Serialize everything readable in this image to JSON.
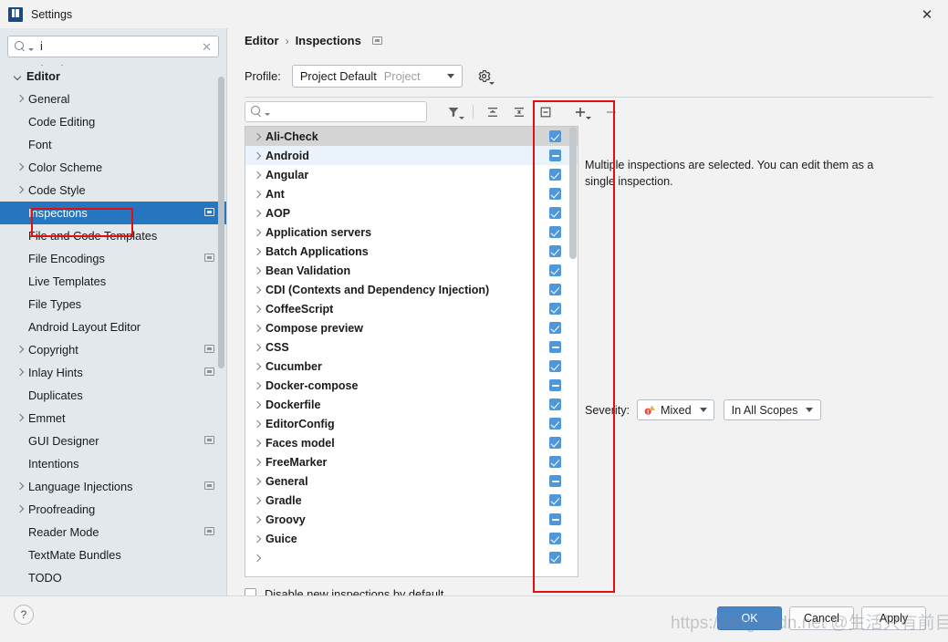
{
  "window": {
    "title": "Settings",
    "app_icon": "intellij-idea-icon",
    "close_label": "✕"
  },
  "sidebar": {
    "search": {
      "value": "i",
      "placeholder": "",
      "clear_label": "✕",
      "icon": "search-icon"
    },
    "partial_top_item": "· ·",
    "items": [
      {
        "label": "Editor",
        "depth": 0,
        "twisty": "down",
        "bold": true,
        "selected": false,
        "badge": false
      },
      {
        "label": "General",
        "depth": 1,
        "twisty": "right",
        "bold": false,
        "selected": false,
        "badge": false
      },
      {
        "label": "Code Editing",
        "depth": 1,
        "twisty": "none",
        "bold": false,
        "selected": false,
        "badge": false
      },
      {
        "label": "Font",
        "depth": 1,
        "twisty": "none",
        "bold": false,
        "selected": false,
        "badge": false
      },
      {
        "label": "Color Scheme",
        "depth": 1,
        "twisty": "right",
        "bold": false,
        "selected": false,
        "badge": false
      },
      {
        "label": "Code Style",
        "depth": 1,
        "twisty": "right",
        "bold": false,
        "selected": false,
        "badge": false
      },
      {
        "label": "Inspections",
        "depth": 1,
        "twisty": "none",
        "bold": false,
        "selected": true,
        "badge": true
      },
      {
        "label": "File and Code Templates",
        "depth": 1,
        "twisty": "none",
        "bold": false,
        "selected": false,
        "badge": false
      },
      {
        "label": "File Encodings",
        "depth": 1,
        "twisty": "none",
        "bold": false,
        "selected": false,
        "badge": true
      },
      {
        "label": "Live Templates",
        "depth": 1,
        "twisty": "none",
        "bold": false,
        "selected": false,
        "badge": false
      },
      {
        "label": "File Types",
        "depth": 1,
        "twisty": "none",
        "bold": false,
        "selected": false,
        "badge": false
      },
      {
        "label": "Android Layout Editor",
        "depth": 1,
        "twisty": "none",
        "bold": false,
        "selected": false,
        "badge": false
      },
      {
        "label": "Copyright",
        "depth": 1,
        "twisty": "right",
        "bold": false,
        "selected": false,
        "badge": true
      },
      {
        "label": "Inlay Hints",
        "depth": 1,
        "twisty": "right",
        "bold": false,
        "selected": false,
        "badge": true
      },
      {
        "label": "Duplicates",
        "depth": 1,
        "twisty": "none",
        "bold": false,
        "selected": false,
        "badge": false
      },
      {
        "label": "Emmet",
        "depth": 1,
        "twisty": "right",
        "bold": false,
        "selected": false,
        "badge": false
      },
      {
        "label": "GUI Designer",
        "depth": 1,
        "twisty": "none",
        "bold": false,
        "selected": false,
        "badge": true
      },
      {
        "label": "Intentions",
        "depth": 1,
        "twisty": "none",
        "bold": false,
        "selected": false,
        "badge": false
      },
      {
        "label": "Language Injections",
        "depth": 1,
        "twisty": "right",
        "bold": false,
        "selected": false,
        "badge": true
      },
      {
        "label": "Proofreading",
        "depth": 1,
        "twisty": "right",
        "bold": false,
        "selected": false,
        "badge": false
      },
      {
        "label": "Reader Mode",
        "depth": 1,
        "twisty": "none",
        "bold": false,
        "selected": false,
        "badge": true
      },
      {
        "label": "TextMate Bundles",
        "depth": 1,
        "twisty": "none",
        "bold": false,
        "selected": false,
        "badge": false
      },
      {
        "label": "TODO",
        "depth": 1,
        "twisty": "none",
        "bold": false,
        "selected": false,
        "badge": false
      }
    ]
  },
  "breadcrumb": {
    "parts": [
      "Editor",
      "Inspections"
    ],
    "separator": "›",
    "badge": "project-scope-badge"
  },
  "profile": {
    "label": "Profile:",
    "selected": "Project Default",
    "scope_hint": "Project",
    "gear_icon": "gear-icon"
  },
  "inspection_toolbar": {
    "search_placeholder": "",
    "search_value": "",
    "icons": [
      {
        "name": "filter-icon",
        "tooltip": "Filter"
      },
      {
        "name": "expand-all-icon",
        "tooltip": "Expand All"
      },
      {
        "name": "collapse-all-icon",
        "tooltip": "Collapse All"
      },
      {
        "name": "group-by-icon",
        "tooltip": "Group"
      },
      {
        "name": "add-icon",
        "tooltip": "Add"
      },
      {
        "name": "remove-icon",
        "tooltip": "Remove"
      }
    ]
  },
  "inspection_list": [
    {
      "label": "Ali-Check",
      "state": "checked",
      "row_highlight": "gray"
    },
    {
      "label": "Android",
      "state": "indeterminate",
      "row_highlight": "blue"
    },
    {
      "label": "Angular",
      "state": "checked",
      "row_highlight": "none"
    },
    {
      "label": "Ant",
      "state": "checked",
      "row_highlight": "none"
    },
    {
      "label": "AOP",
      "state": "checked",
      "row_highlight": "none"
    },
    {
      "label": "Application servers",
      "state": "checked",
      "row_highlight": "none"
    },
    {
      "label": "Batch Applications",
      "state": "checked",
      "row_highlight": "none"
    },
    {
      "label": "Bean Validation",
      "state": "checked",
      "row_highlight": "none"
    },
    {
      "label": "CDI (Contexts and Dependency Injection)",
      "state": "checked",
      "row_highlight": "none"
    },
    {
      "label": "CoffeeScript",
      "state": "checked",
      "row_highlight": "none"
    },
    {
      "label": "Compose preview",
      "state": "checked",
      "row_highlight": "none"
    },
    {
      "label": "CSS",
      "state": "indeterminate",
      "row_highlight": "none"
    },
    {
      "label": "Cucumber",
      "state": "checked",
      "row_highlight": "none"
    },
    {
      "label": "Docker-compose",
      "state": "indeterminate",
      "row_highlight": "none"
    },
    {
      "label": "Dockerfile",
      "state": "checked",
      "row_highlight": "none"
    },
    {
      "label": "EditorConfig",
      "state": "checked",
      "row_highlight": "none"
    },
    {
      "label": "Faces model",
      "state": "checked",
      "row_highlight": "none"
    },
    {
      "label": "FreeMarker",
      "state": "checked",
      "row_highlight": "none"
    },
    {
      "label": "General",
      "state": "indeterminate",
      "row_highlight": "none"
    },
    {
      "label": "Gradle",
      "state": "checked",
      "row_highlight": "none"
    },
    {
      "label": "Groovy",
      "state": "indeterminate",
      "row_highlight": "none"
    },
    {
      "label": "Guice",
      "state": "checked",
      "row_highlight": "none"
    },
    {
      "label": "",
      "state": "checked",
      "row_highlight": "none"
    }
  ],
  "detail": {
    "message": "Multiple inspections are selected. You can edit them as a single inspection.",
    "severity_label": "Severity:",
    "severity_value": "Mixed",
    "severity_icon": "mixed-severity-icon",
    "scope_value": "In All Scopes"
  },
  "options": {
    "disable_new_label": "Disable new inspections by default",
    "disable_new_checked": false
  },
  "footer": {
    "help_label": "?",
    "ok_label": "OK",
    "cancel_label": "Cancel",
    "apply_label": "Apply"
  },
  "watermark": {
    "text": "https://blog.csdn.net @生活只有前目"
  },
  "colors": {
    "accent": "#2675bf",
    "checkbox": "#4f97d8",
    "annotation": "#e11010",
    "sidebar_bg": "#e3e8ed",
    "dialog_bg": "#f2f2f2"
  }
}
